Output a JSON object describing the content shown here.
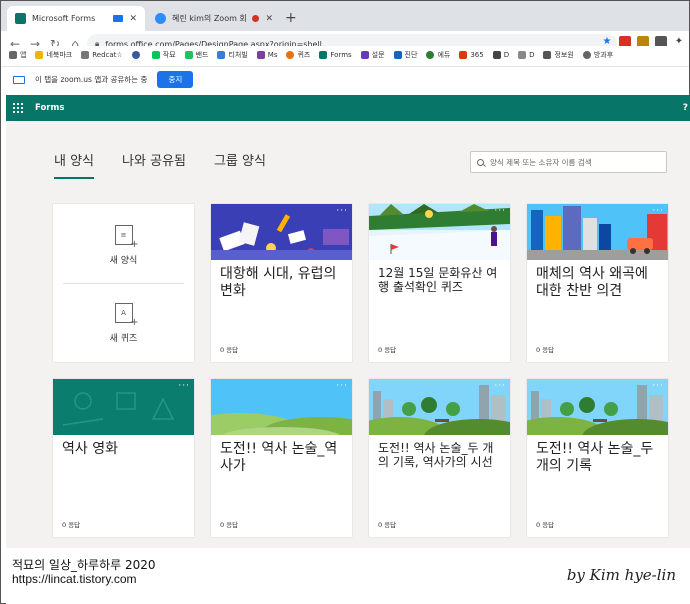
{
  "browser": {
    "tabs": [
      {
        "label": "Microsoft Forms",
        "favicon_color": "#077568"
      },
      {
        "label": "혜린 kim의 Zoom 회의",
        "favicon_color": "#2d8cff"
      }
    ],
    "url": "forms.office.com/Pages/DesignPage.aspx?origin=shell",
    "bookmarks": [
      {
        "label": "앱",
        "color": "#666666"
      },
      {
        "label": "네북마크",
        "color": "#f2b400"
      },
      {
        "label": "Redcat☆",
        "color": "#777777"
      },
      {
        "label": "",
        "color": "#3b5998"
      },
      {
        "label": "작묘",
        "color": "#03c75a"
      },
      {
        "label": "밴드",
        "color": "#21c25e"
      },
      {
        "label": "티처빌",
        "color": "#3a7bd5"
      },
      {
        "label": "Ms",
        "color": "#7b3fa0"
      },
      {
        "label": "퀴즈",
        "color": "#e8710a"
      },
      {
        "label": "Forms",
        "color": "#077568"
      },
      {
        "label": "설문",
        "color": "#673ab7"
      },
      {
        "label": "진단",
        "color": "#1565c0"
      },
      {
        "label": "에듀",
        "color": "#2e7d32"
      },
      {
        "label": "365",
        "color": "#d83b01"
      },
      {
        "label": "D",
        "color": "#444444"
      },
      {
        "label": "D",
        "color": "#888888"
      },
      {
        "label": "정보원",
        "color": "#555555"
      },
      {
        "label": "방과후",
        "color": "#666666"
      }
    ]
  },
  "sharebar": {
    "message": "이 탭을 zoom.us 앱과 공유하는 중",
    "stop_label": "중지"
  },
  "app": {
    "title": "Forms"
  },
  "nav": {
    "tabs": [
      "내 양식",
      "나와 공유됨",
      "그룹 양식"
    ],
    "search_placeholder": "양식 제목 또는 소유자 이름 검색"
  },
  "new_card": {
    "new_form_label": "새 양식",
    "new_quiz_label": "새 퀴즈",
    "form_icon_glyph": "≡",
    "quiz_icon_glyph": "A"
  },
  "cards": [
    {
      "title": "대항해 시대, 유럽의 변화",
      "responses": "0 응답",
      "banner": "desk"
    },
    {
      "title": "12월 15일 문화유산 여행 출석확인 퀴즈",
      "responses": "0 응답",
      "banner": "snow"
    },
    {
      "title": "매체의 역사 왜곡에 대한 찬반 의견",
      "responses": "0 응답",
      "banner": "city"
    },
    {
      "title": "역사 영화",
      "responses": "0 응답",
      "banner": "teal"
    },
    {
      "title": "도전!! 역사 논술_역사가",
      "responses": "0 응답",
      "banner": "hills"
    },
    {
      "title": "도전!! 역사 논술_두 개의 기록, 역사가의 시선",
      "responses": "0 응답",
      "banner": "park"
    },
    {
      "title": "도전!! 역사 논술_두 개의 기록",
      "responses": "0 응답",
      "banner": "park"
    }
  ],
  "watermark": {
    "line1": "적묘의 일상_하루하루 2020",
    "line2": "https://lincat.tistory.com",
    "signature": "by Kim hye-lin"
  }
}
